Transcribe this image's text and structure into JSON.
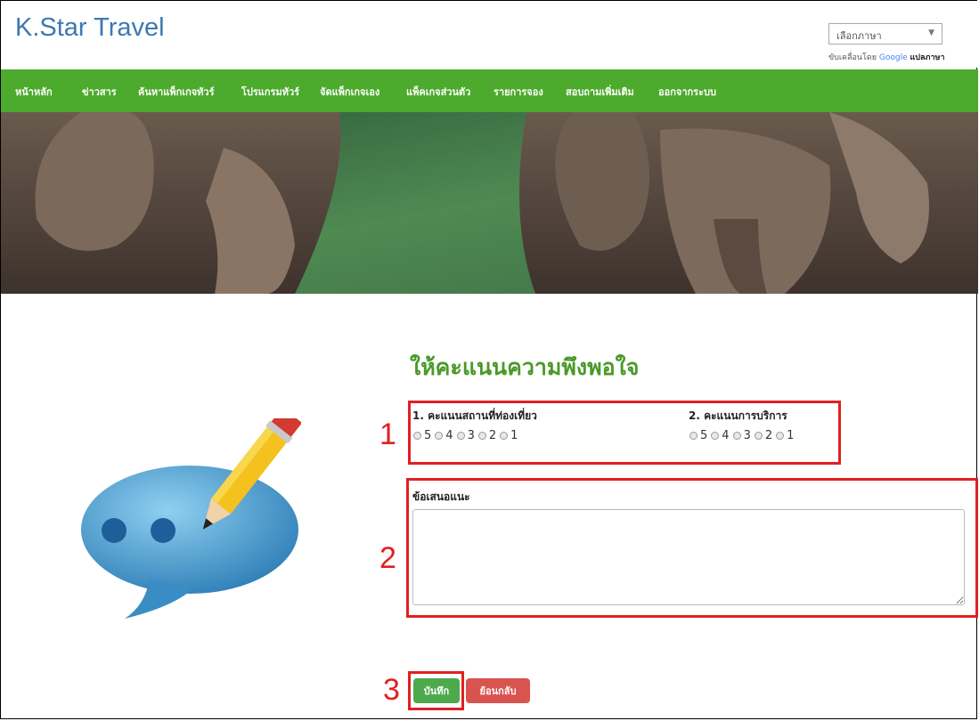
{
  "header": {
    "brand": "K.Star Travel",
    "language_select": "เลือกภาษา",
    "powered_by_prefix": "ขับเคลื่อนโดย",
    "powered_by_google": "Google",
    "powered_by_translate": "แปลภาษา"
  },
  "nav": {
    "items": [
      "หน้าหลัก",
      "ข่าวสาร",
      "ค้นหาแพ็กเกจทัวร์",
      "โปรแกรมทัวร์",
      "จัดแพ็กเกจเอง",
      "แพ็คเกจส่วนตัว",
      "รายการจอง",
      "สอบถามเพิ่มเติม",
      "ออกจากระบบ"
    ]
  },
  "form": {
    "title": "ให้คะแนนความพึงพอใจ",
    "question1": "1. คะแนนสถานที่ท่องเที่ยว",
    "question2": "2. คะแนนการบริการ",
    "rating_options": [
      "5",
      "4",
      "3",
      "2",
      "1"
    ],
    "comment_label": "ข้อเสนอแนะ",
    "save_button": "บันทึก",
    "back_button": "ย้อนกลับ"
  },
  "callouts": [
    "1",
    "2",
    "3"
  ],
  "colors": {
    "nav_green": "#4caa2c",
    "title_green": "#4a9a2a",
    "brand_blue": "#3e78b2",
    "highlight_red": "#e02020"
  }
}
